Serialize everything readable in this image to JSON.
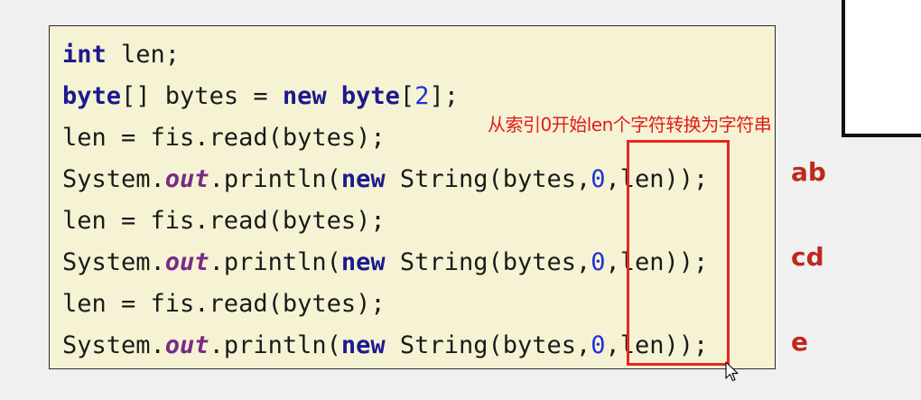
{
  "code": {
    "line1": {
      "kw": "int",
      "rest": " len;"
    },
    "line2": {
      "kw1": "byte",
      "mid1": "[] bytes = ",
      "kw2": "new",
      "mid2": " ",
      "kw3": "byte",
      "open": "[",
      "num": "2",
      "close": "];"
    },
    "line3": {
      "text": "len = fis.read(bytes);"
    },
    "line4": {
      "pre": "System.",
      "fld": "out",
      "mid": ".println(",
      "kw": "new",
      "mid2": " String(bytes,",
      "num": "0",
      "post": ",len));"
    },
    "line5": {
      "text": "len = fis.read(bytes);"
    },
    "line6": {
      "pre": "System.",
      "fld": "out",
      "mid": ".println(",
      "kw": "new",
      "mid2": " String(bytes,",
      "num": "0",
      "post": ",len));"
    },
    "line7": {
      "text": "len = fis.read(bytes);"
    },
    "line8": {
      "pre": "System.",
      "fld": "out",
      "mid": ".println(",
      "kw": "new",
      "mid2": " String(bytes,",
      "num": "0",
      "post": ",len));"
    }
  },
  "annotation": "从索引0开始len个字符转换为字符串",
  "outputs": [
    "ab",
    "cd",
    "e"
  ],
  "colors": {
    "keyword": "#1c1a8e",
    "field": "#7a2a86",
    "number": "#1f32d8",
    "annotation": "#e01b1b",
    "output": "#c0281c",
    "codeBackground": "#f6f3d4"
  }
}
